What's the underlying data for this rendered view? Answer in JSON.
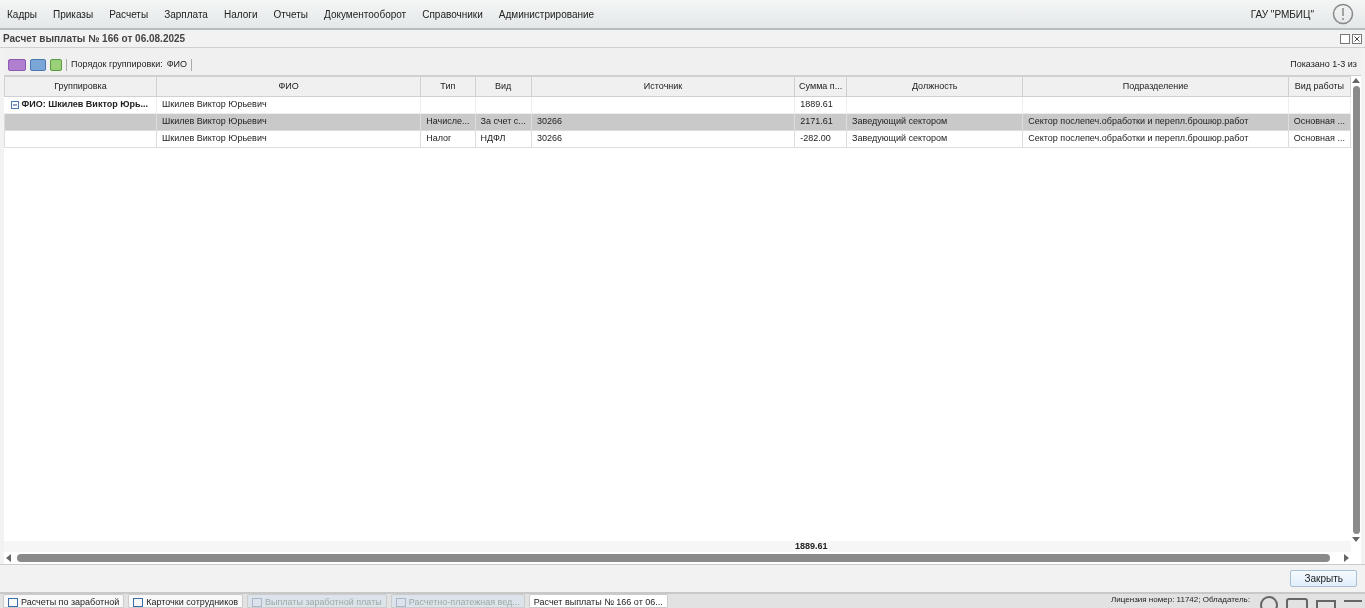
{
  "menu": [
    "Кадры",
    "Приказы",
    "Расчеты",
    "Зарплата",
    "Налоги",
    "Отчеты",
    "Документооборот",
    "Справочники",
    "Администрирование"
  ],
  "org": "ГАУ \"РМБИЦ\"",
  "window": {
    "title": "Расчет выплаты № 166 от 06.08.2025"
  },
  "toolbar": {
    "grouping_label": "Порядок группировки:",
    "grouping_value": "ФИО",
    "shown": "Показано 1-3 из"
  },
  "table": {
    "columns": [
      "Группировка",
      "ФИО",
      "Тип",
      "Вид",
      "Источник",
      "Сумма п...",
      "Должность",
      "Подразделение",
      "Вид работы"
    ],
    "group": {
      "label": "ФИО: Шкилев Виктор Юрь...",
      "expanded": true,
      "cells": [
        "Шкилев Виктор Юрьевич",
        "",
        "",
        "",
        "1889.61",
        "",
        "",
        ""
      ]
    },
    "rows": [
      {
        "selected": true,
        "cells": [
          "",
          "Шкилев Виктор Юрьевич",
          "Начисле...",
          "За счет с...",
          "30266",
          "2171.61",
          "Заведующий сектором",
          "Сектор послепеч.обработки и перепл.брошюр.работ",
          "Основная ..."
        ]
      },
      {
        "selected": false,
        "cells": [
          "",
          "Шкилев Виктор Юрьевич",
          "Налог",
          "НДФЛ",
          "30266",
          "-282.00",
          "Заведующий сектором",
          "Сектор послепеч.обработки и перепл.брошюр.работ",
          "Основная ..."
        ]
      }
    ],
    "total": "1889.61"
  },
  "close_button": "Закрыть",
  "taskbar": [
    {
      "label": "Расчеты по заработной",
      "disabled": false,
      "selected": false
    },
    {
      "label": "Карточки сотрудников",
      "disabled": false,
      "selected": false
    },
    {
      "label": "Выплаты заработной платы",
      "disabled": true,
      "selected": false
    },
    {
      "label": "Расчетно-платежная вед...",
      "disabled": true,
      "selected": false
    },
    {
      "label": "Расчет выплаты № 166 от 06...",
      "disabled": false,
      "selected": true
    }
  ],
  "license": "Лицензия номер: 11742; Обладатель:"
}
